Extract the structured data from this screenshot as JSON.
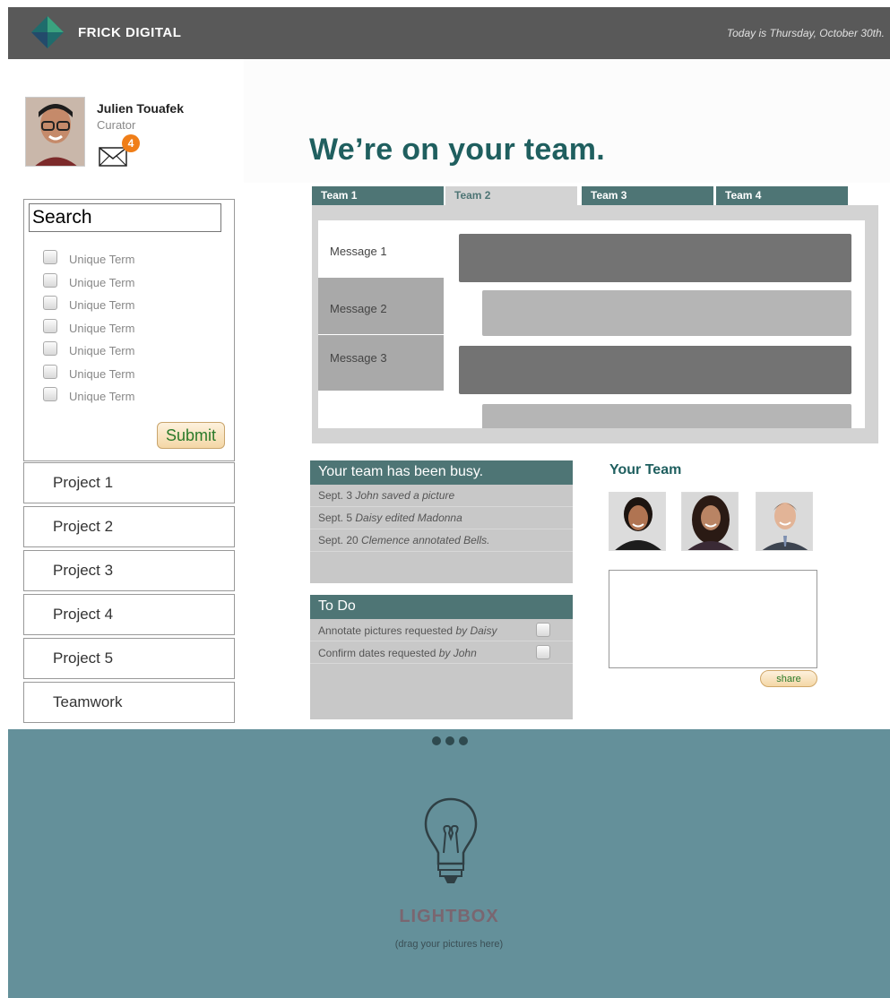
{
  "header": {
    "brand": "FRICK DIGITAL",
    "date": "Today is Thursday, October 30th."
  },
  "profile": {
    "name": "Julien Touafek",
    "role": "Curator",
    "unread_count": "4"
  },
  "hero": {
    "title": "We’re on your team."
  },
  "search": {
    "placeholder": "Search",
    "terms": [
      "Unique Term",
      "Unique Term",
      "Unique Term",
      "Unique Term",
      "Unique Term",
      "Unique Term",
      "Unique Term"
    ],
    "submit_label": "Submit"
  },
  "projects": [
    "Project 1",
    "Project 2",
    "Project 3",
    "Project 4",
    "Project 5",
    "Teamwork"
  ],
  "tabs": [
    "Team 1",
    "Team 2",
    "Team 3",
    "Team 4"
  ],
  "active_tab": "Team 2",
  "messages": [
    "Message 1",
    "Message 2",
    "Message 3"
  ],
  "activity": {
    "title": "Your team has been busy.",
    "items": [
      {
        "date": "Sept. 3",
        "text": "John saved a picture"
      },
      {
        "date": "Sept. 5",
        "text": "Daisy edited Madonna"
      },
      {
        "date": "Sept. 20",
        "text": "Clemence annotated Bells."
      }
    ]
  },
  "todo": {
    "title": "To Do",
    "items": [
      {
        "text": "Annotate pictures requested",
        "by": "by Daisy"
      },
      {
        "text": "Confirm dates requested",
        "by": "by John"
      }
    ]
  },
  "team": {
    "title": "Your Team",
    "share_label": "share"
  },
  "lightbox": {
    "title": "LIGHTBOX",
    "subtitle": "(drag your pictures here)"
  },
  "colors": {
    "accent": "#1f5f5f",
    "tab": "#4e7575",
    "lightbox": "#64909a",
    "badge": "#f07e18"
  }
}
